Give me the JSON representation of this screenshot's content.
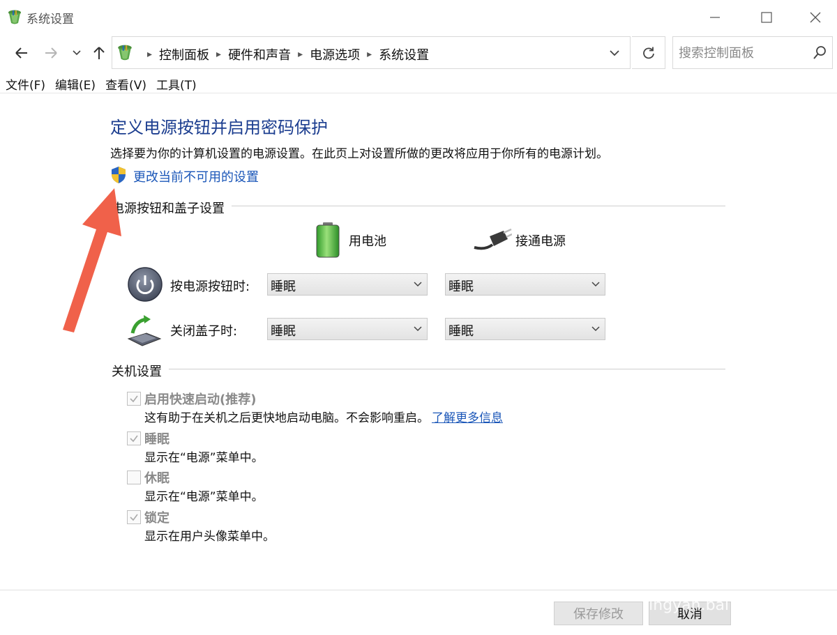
{
  "window": {
    "title": "系统设置"
  },
  "address": {
    "crumbs": [
      "控制面板",
      "硬件和声音",
      "电源选项",
      "系统设置"
    ]
  },
  "search": {
    "placeholder": "搜索控制面板"
  },
  "menu": [
    "文件(F)",
    "编辑(E)",
    "查看(V)",
    "工具(T)"
  ],
  "page": {
    "heading": "定义电源按钮并启用密码保护",
    "description": "选择要为你的计算机设置的电源设置。在此页上对设置所做的更改将应用于你所有的电源计划。",
    "change_link": "更改当前不可用的设置"
  },
  "power_group": {
    "label": "电源按钮和盖子设置",
    "columns": [
      "用电池",
      "接通电源"
    ],
    "rows": [
      {
        "label": "按电源按钮时:",
        "battery": "睡眠",
        "plugged": "睡眠"
      },
      {
        "label": "关闭盖子时:",
        "battery": "睡眠",
        "plugged": "睡眠"
      }
    ]
  },
  "shutdown_group": {
    "label": "关机设置",
    "options": [
      {
        "title": "启用快速启动(推荐)",
        "desc": "这有助于在关机之后更快地启动电脑。不会影响重启。",
        "link": "了解更多信息",
        "checked": true
      },
      {
        "title": "睡眠",
        "desc": "显示在“电源”菜单中。",
        "checked": true
      },
      {
        "title": "休眠",
        "desc": "显示在“电源”菜单中。",
        "checked": false
      },
      {
        "title": "锁定",
        "desc": "显示在用户头像菜单中。",
        "checked": true
      }
    ]
  },
  "buttons": {
    "save": "保存修改",
    "cancel": "取消"
  },
  "watermark": "jingyan.bai",
  "colors": {
    "heading": "#1b3d8f",
    "link": "#1a56b8",
    "arrow": "#f0614a"
  }
}
